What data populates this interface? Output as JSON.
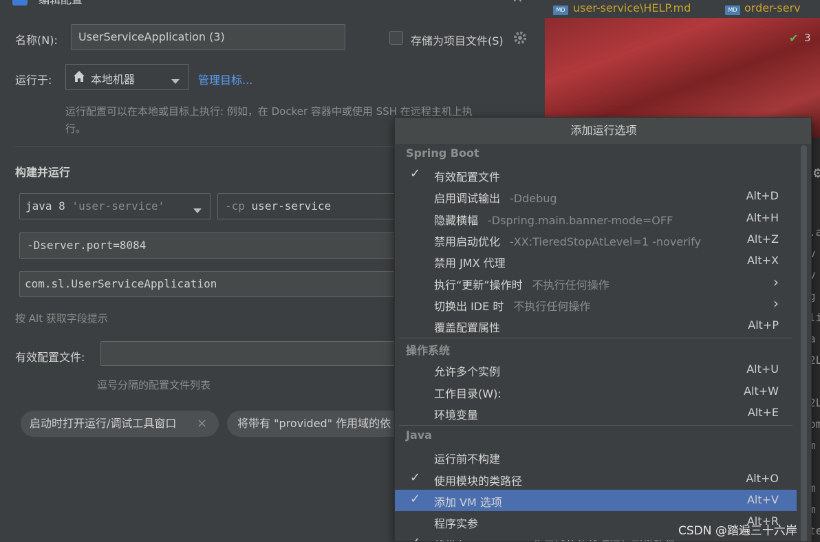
{
  "dialog": {
    "title": "编辑配置",
    "name_label": "名称(N):",
    "name_value": "UserServiceApplication (3)",
    "store_label": "存储为项目文件(S)",
    "run_on_label": "运行于:",
    "run_on_value": "本地机器",
    "manage_targets": "管理目标...",
    "run_on_hint_1": "运行配置可以在本地或目标上执行: 例如，在 Docker 容器中或使用 SSH 在远程主机上执",
    "run_on_hint_2": "行。",
    "build_run_heading": "构建并运行",
    "jdk_prefix": "java 8",
    "jdk_module": "'user-service'",
    "cp_flag": "-cp",
    "cp_value": "user-service",
    "vm_options": "-Dserver.port=8084",
    "main_class": "com.sl.UserServiceApplication",
    "alt_hint": "按 Alt 获取字段提示",
    "profiles_label": "有效配置文件:",
    "profiles_hint": "逗号分隔的配置文件列表",
    "chip1": "启动时打开运行/调试工具窗口",
    "chip2": "将带有 \"provided\" 作用域的依"
  },
  "editor": {
    "tab1": "user-service\\HELP.md",
    "tab2": "order-serv",
    "md_badge": "MD",
    "check_count": "3",
    "code_fragments": [
      ".a",
      "v",
      "v",
      "g",
      "li",
      "a",
      "2L",
      "",
      "2L",
      "om",
      "m",
      "",
      "m",
      "m",
      "te",
      "m"
    ]
  },
  "popup": {
    "title": "添加运行选项",
    "groups": [
      {
        "name": "Spring Boot",
        "items": [
          {
            "label": "有效配置文件",
            "hint": "",
            "shortcut": "",
            "checked": true,
            "submenu": false
          },
          {
            "label": "启用调试输出",
            "hint": "-Ddebug",
            "shortcut": "Alt+D",
            "checked": false,
            "submenu": false
          },
          {
            "label": "隐藏横幅",
            "hint": "-Dspring.main.banner-mode=OFF",
            "shortcut": "Alt+H",
            "checked": false,
            "submenu": false
          },
          {
            "label": "禁用启动优化",
            "hint": "-XX:TieredStopAtLevel=1 -noverify",
            "shortcut": "Alt+Z",
            "checked": false,
            "submenu": false
          },
          {
            "label": "禁用 JMX 代理",
            "hint": "",
            "shortcut": "Alt+X",
            "checked": false,
            "submenu": false
          },
          {
            "label": "执行“更新”操作时",
            "hint": "不执行任何操作",
            "shortcut": "",
            "checked": false,
            "submenu": true
          },
          {
            "label": "切换出 IDE 时",
            "hint": "不执行任何操作",
            "shortcut": "",
            "checked": false,
            "submenu": true
          },
          {
            "label": "覆盖配置属性",
            "hint": "",
            "shortcut": "Alt+P",
            "checked": false,
            "submenu": false
          }
        ]
      },
      {
        "name": "操作系统",
        "items": [
          {
            "label": "允许多个实例",
            "hint": "",
            "shortcut": "Alt+U",
            "checked": false,
            "submenu": false
          },
          {
            "label": "工作目录(W):",
            "hint": "",
            "shortcut": "Alt+W",
            "checked": false,
            "submenu": false
          },
          {
            "label": "环境变量",
            "hint": "",
            "shortcut": "Alt+E",
            "checked": false,
            "submenu": false
          }
        ]
      },
      {
        "name": "Java",
        "items": [
          {
            "label": "运行前不构建",
            "hint": "",
            "shortcut": "",
            "checked": false,
            "submenu": false
          },
          {
            "label": "使用模块的类路径",
            "hint": "",
            "shortcut": "Alt+O",
            "checked": true,
            "submenu": false
          },
          {
            "label": "添加 VM 选项",
            "hint": "",
            "shortcut": "Alt+V",
            "checked": true,
            "submenu": false,
            "selected": true
          },
          {
            "label": "程序实参",
            "hint": "",
            "shortcut": "Alt+R",
            "checked": false,
            "submenu": false
          },
          {
            "label": "将带有 \"provided\" 作用域的依赖项添加到类路径",
            "hint": "",
            "shortcut": "",
            "checked": true,
            "submenu": false
          }
        ]
      }
    ]
  },
  "watermark": "CSDN @踏遍三十六岸",
  "colors": {
    "accent": "#589df6",
    "selection": "#4b6eaf",
    "background": "#3c3f41"
  }
}
